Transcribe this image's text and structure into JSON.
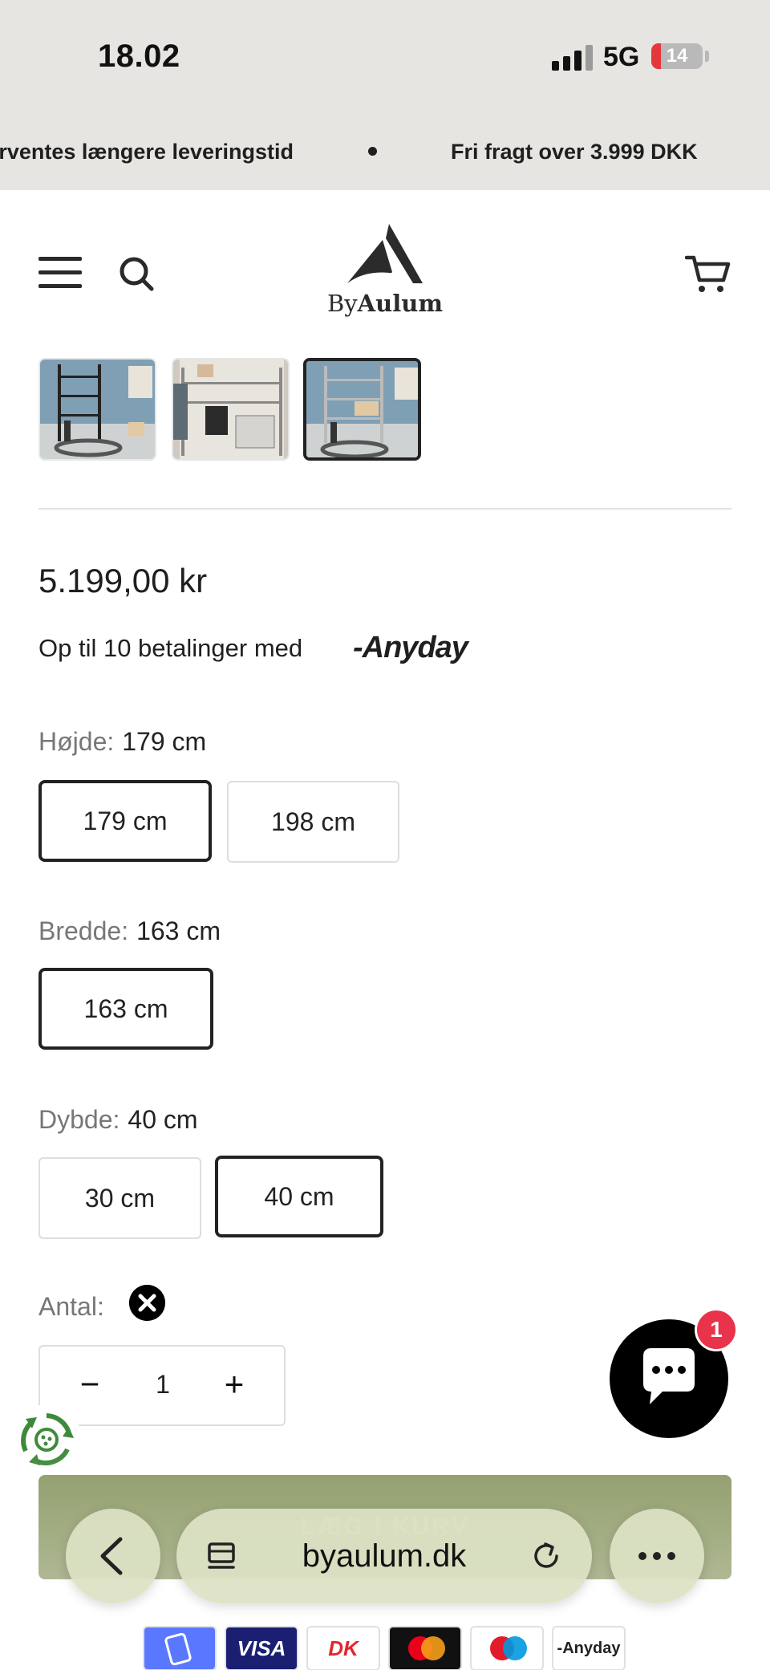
{
  "status_bar": {
    "time": "18.02",
    "network": "5G",
    "battery": "14"
  },
  "announcement": {
    "left_text": "rventes længere leveringstid",
    "right_text": "Fri fragt over 3.999 DKK"
  },
  "header": {
    "logo_by": "By",
    "logo_name": "Aulum"
  },
  "product": {
    "price": "5.199,00 kr",
    "installments_text": "Op til 10 betalinger med",
    "installments_provider": "-Anyday"
  },
  "options": {
    "height": {
      "label": "Højde:",
      "selected": "179 cm",
      "values": [
        "179 cm",
        "198 cm"
      ]
    },
    "width": {
      "label": "Bredde:",
      "selected": "163 cm",
      "values": [
        "163 cm"
      ]
    },
    "depth": {
      "label": "Dybde:",
      "selected": "40 cm",
      "values": [
        "30 cm",
        "40 cm"
      ]
    }
  },
  "quantity": {
    "label": "Antal:",
    "minus": "−",
    "value": "1",
    "plus": "+"
  },
  "chat": {
    "badge_count": "1"
  },
  "add_to_cart": {
    "label": "LÆG I KURV"
  },
  "browser": {
    "url": "byaulum.dk"
  },
  "payments": [
    {
      "name": "MobilePay",
      "label": "",
      "color": "#5a78ff"
    },
    {
      "name": "Visa",
      "label": "VISA",
      "color": "#1a1f71"
    },
    {
      "name": "Dankort",
      "label": "DK",
      "color": "#ffffff"
    },
    {
      "name": "Mastercard",
      "label": "",
      "color": "#111111"
    },
    {
      "name": "Maestro",
      "label": "",
      "color": "#ffffff"
    },
    {
      "name": "Anyday",
      "label": "-Anyday",
      "color": "#ffffff"
    }
  ]
}
